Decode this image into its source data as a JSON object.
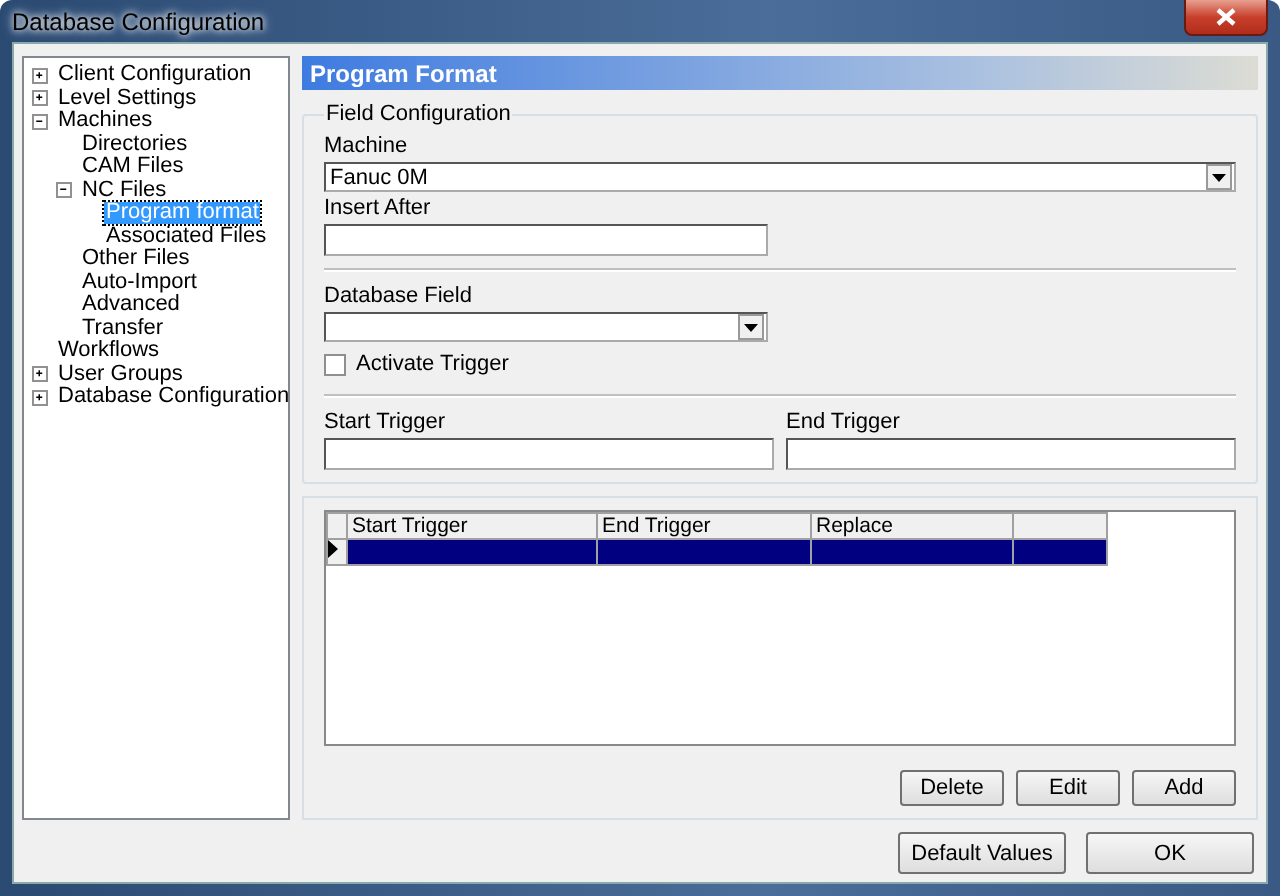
{
  "window": {
    "title": "Database Configuration"
  },
  "tree": [
    {
      "label": "Client Configuration",
      "expanded": false,
      "selected": false
    },
    {
      "label": "Level Settings",
      "expanded": false,
      "selected": false
    },
    {
      "label": "Machines",
      "expanded": true,
      "selected": false,
      "children": [
        {
          "label": "Directories",
          "selected": false
        },
        {
          "label": "CAM Files",
          "selected": false
        },
        {
          "label": "NC Files",
          "expanded": true,
          "selected": false,
          "children": [
            {
              "label": "Program format",
              "selected": true
            },
            {
              "label": "Associated Files",
              "selected": false
            }
          ]
        },
        {
          "label": "Other Files",
          "selected": false
        },
        {
          "label": "Auto-Import",
          "selected": false
        },
        {
          "label": "Advanced",
          "selected": false
        },
        {
          "label": "Transfer",
          "selected": false
        }
      ]
    },
    {
      "label": "Workflows",
      "selected": false
    },
    {
      "label": "User Groups",
      "expanded": false,
      "selected": false
    },
    {
      "label": "Database Configuration",
      "expanded": false,
      "selected": false
    }
  ],
  "page_title": "Program Format",
  "field_configuration": {
    "title": "Field Configuration",
    "machine": {
      "label": "Machine",
      "value": "Fanuc 0M"
    },
    "insert_after": {
      "label": "Insert After"
    },
    "database_field": {
      "label": "Database Field"
    },
    "activate_trigger": {
      "label": "Activate Trigger",
      "checked": false
    },
    "start_trigger": {
      "label": "Start Trigger"
    },
    "end_trigger": {
      "label": "End Trigger"
    }
  },
  "grid": {
    "columns": [
      "Start Trigger",
      "End Trigger",
      "Replace"
    ],
    "rows": [
      {
        "selected": true
      }
    ]
  },
  "grid_buttons": [
    "Delete",
    "Edit",
    "Add"
  ],
  "footer_buttons": [
    "Default Values",
    "OK"
  ]
}
